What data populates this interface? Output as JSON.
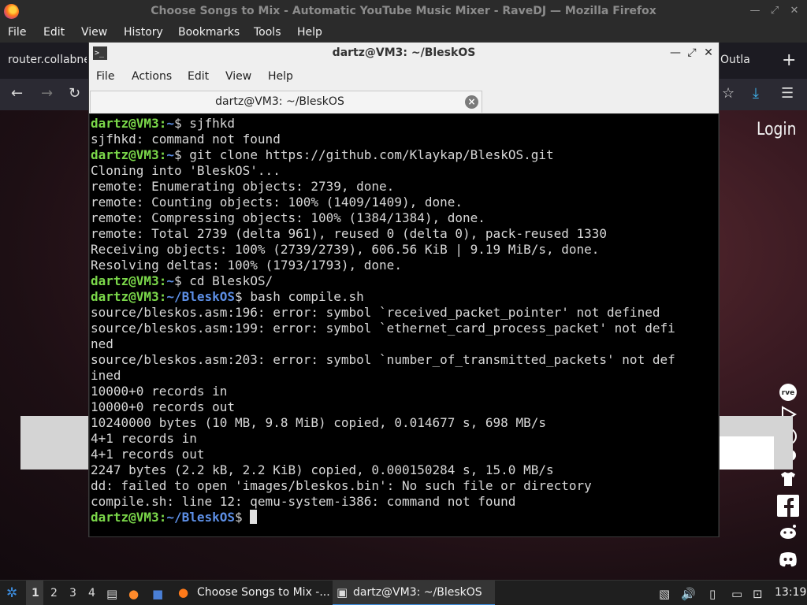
{
  "firefox": {
    "window_title": "Choose Songs to Mix - Automatic YouTube Music Mixer - RaveDJ — Mozilla Firefox",
    "menu": [
      "File",
      "Edit",
      "View",
      "History",
      "Bookmarks",
      "Tools",
      "Help"
    ],
    "tab_left_label": "router.collabne",
    "tab_right_label": "Outla",
    "new_tab": "+"
  },
  "website": {
    "login_label": "Login",
    "social_icons": [
      "rave-icon",
      "play-store-icon",
      "app-store-icon",
      "patreon-icon",
      "tshirt-icon",
      "facebook-icon",
      "reddit-icon",
      "discord-icon"
    ]
  },
  "terminal": {
    "title": "dartz@VM3: ~/BleskOS",
    "menu": [
      "File",
      "Actions",
      "Edit",
      "View",
      "Help"
    ],
    "tab_label": "dartz@VM3: ~/BleskOS",
    "lines": [
      {
        "user": "dartz@VM3",
        "path": "~",
        "cmd": "$ sjfhkd"
      },
      {
        "text": "sjfhkd: command not found"
      },
      {
        "user": "dartz@VM3",
        "path": "~",
        "cmd": "$ git clone https://github.com/Klaykap/BleskOS.git"
      },
      {
        "text": "Cloning into 'BleskOS'..."
      },
      {
        "text": "remote: Enumerating objects: 2739, done."
      },
      {
        "text": "remote: Counting objects: 100% (1409/1409), done."
      },
      {
        "text": "remote: Compressing objects: 100% (1384/1384), done."
      },
      {
        "text": "remote: Total 2739 (delta 961), reused 0 (delta 0), pack-reused 1330"
      },
      {
        "text": "Receiving objects: 100% (2739/2739), 606.56 KiB | 9.19 MiB/s, done."
      },
      {
        "text": "Resolving deltas: 100% (1793/1793), done."
      },
      {
        "user": "dartz@VM3",
        "path": "~",
        "cmd": "$ cd BleskOS/"
      },
      {
        "user": "dartz@VM3",
        "path": "~/BleskOS",
        "cmd": "$ bash compile.sh"
      },
      {
        "text": "source/bleskos.asm:196: error: symbol `received_packet_pointer' not defined"
      },
      {
        "text": "source/bleskos.asm:199: error: symbol `ethernet_card_process_packet' not defi"
      },
      {
        "text": "ned"
      },
      {
        "text": "source/bleskos.asm:203: error: symbol `number_of_transmitted_packets' not def"
      },
      {
        "text": "ined"
      },
      {
        "text": "10000+0 records in"
      },
      {
        "text": "10000+0 records out"
      },
      {
        "text": "10240000 bytes (10 MB, 9.8 MiB) copied, 0.014677 s, 698 MB/s"
      },
      {
        "text": "4+1 records in"
      },
      {
        "text": "4+1 records out"
      },
      {
        "text": "2247 bytes (2.2 kB, 2.2 KiB) copied, 0.000150284 s, 15.0 MB/s"
      },
      {
        "text": "dd: failed to open 'images/bleskos.bin': No such file or directory"
      },
      {
        "text": "compile.sh: line 12: qemu-system-i386: command not found"
      },
      {
        "user": "dartz@VM3",
        "path": "~/BleskOS",
        "cmd": "$ ",
        "cursor": true
      }
    ]
  },
  "taskbar": {
    "workspaces": [
      "1",
      "2",
      "3",
      "4"
    ],
    "active_workspace": "1",
    "tasks": [
      {
        "label": "Choose Songs to Mix -...",
        "icon": "firefox-icon"
      },
      {
        "label": "dartz@VM3: ~/BleskOS",
        "icon": "terminal-icon"
      }
    ],
    "clock": "13:19"
  },
  "colors": {
    "prompt_user": "#7bd84a",
    "prompt_path": "#5d8fe6",
    "terminal_bg": "#000000",
    "taskbar_bg": "#1f1f1f"
  }
}
